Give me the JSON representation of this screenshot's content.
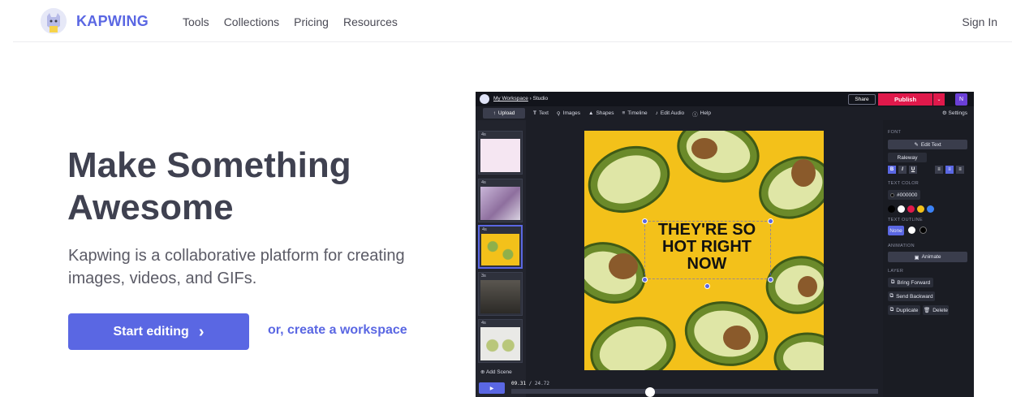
{
  "nav": {
    "brand": "KAPWING",
    "links": [
      "Tools",
      "Collections",
      "Pricing",
      "Resources"
    ],
    "sign_in": "Sign In"
  },
  "hero": {
    "title_line1": "Make Something",
    "title_line2": "Awesome",
    "subtitle": "Kapwing is a collaborative platform for creating images, videos, and GIFs.",
    "cta_label": "Start editing",
    "cta_arrow": "›",
    "secondary_link": "or, create a workspace"
  },
  "editor": {
    "breadcrumb_link": "My Workspace",
    "breadcrumb_rest": " › Studio",
    "share": "Share",
    "publish": "Publish",
    "user_initial": "N",
    "settings": "Settings",
    "tools": {
      "upload": "Upload",
      "text": "Text",
      "images": "Images",
      "shapes": "Shapes",
      "timeline": "Timeline",
      "edit_audio": "Edit Audio",
      "help": "Help"
    },
    "scenes": [
      {
        "duration": "4s"
      },
      {
        "duration": "4s"
      },
      {
        "duration": "4s"
      },
      {
        "duration": "3s"
      },
      {
        "duration": "4s"
      }
    ],
    "add_scene": "Add Scene",
    "time_current": "09.31",
    "time_total": "24.72",
    "canvas_text": "THEY'RE SO HOT RIGHT NOW",
    "panel": {
      "font_label": "FONT",
      "edit_text": "Edit Text",
      "font_name": "Raleway",
      "text_color_label": "TEXT COLOR",
      "color_value": "#000000",
      "outline_label": "TEXT OUTLINE",
      "outline_none": "None",
      "animation_label": "ANIMATION",
      "animate": "Animate",
      "layer_label": "LAYER",
      "bring_forward": "Bring Forward",
      "send_backward": "Send Backward",
      "duplicate": "Duplicate",
      "delete": "Delete",
      "swatches": [
        "#000000",
        "#ffffff",
        "#e0194b",
        "#f3c11a",
        "#3b82f6"
      ]
    }
  },
  "colors": {
    "brand": "#5a67e3",
    "publish": "#e0194b",
    "canvas_bg": "#f3c11a"
  }
}
